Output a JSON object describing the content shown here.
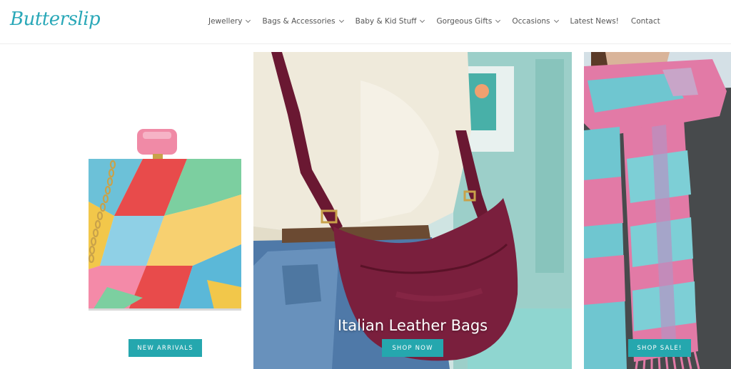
{
  "brand": {
    "logo_text": "Butterslip"
  },
  "nav": {
    "items": [
      {
        "label": "Jewellery",
        "has_dropdown": true
      },
      {
        "label": "Bags & Accessories",
        "has_dropdown": true
      },
      {
        "label": "Baby & Kid Stuff",
        "has_dropdown": true
      },
      {
        "label": "Gorgeous Gifts",
        "has_dropdown": true
      },
      {
        "label": "Occasions",
        "has_dropdown": true
      },
      {
        "label": "Latest News!",
        "has_dropdown": false
      },
      {
        "label": "Contact",
        "has_dropdown": false
      }
    ]
  },
  "hero": {
    "panels": [
      {
        "button_label": "NEW ARRIVALS"
      },
      {
        "title": "Italian Leather Bags",
        "button_label": "SHOP NOW"
      },
      {
        "button_label": "SHOP SALE!"
      }
    ]
  },
  "colors": {
    "accent": "#25a7ae",
    "logo": "#2aa8b8",
    "bag": "#7a1f3d"
  }
}
